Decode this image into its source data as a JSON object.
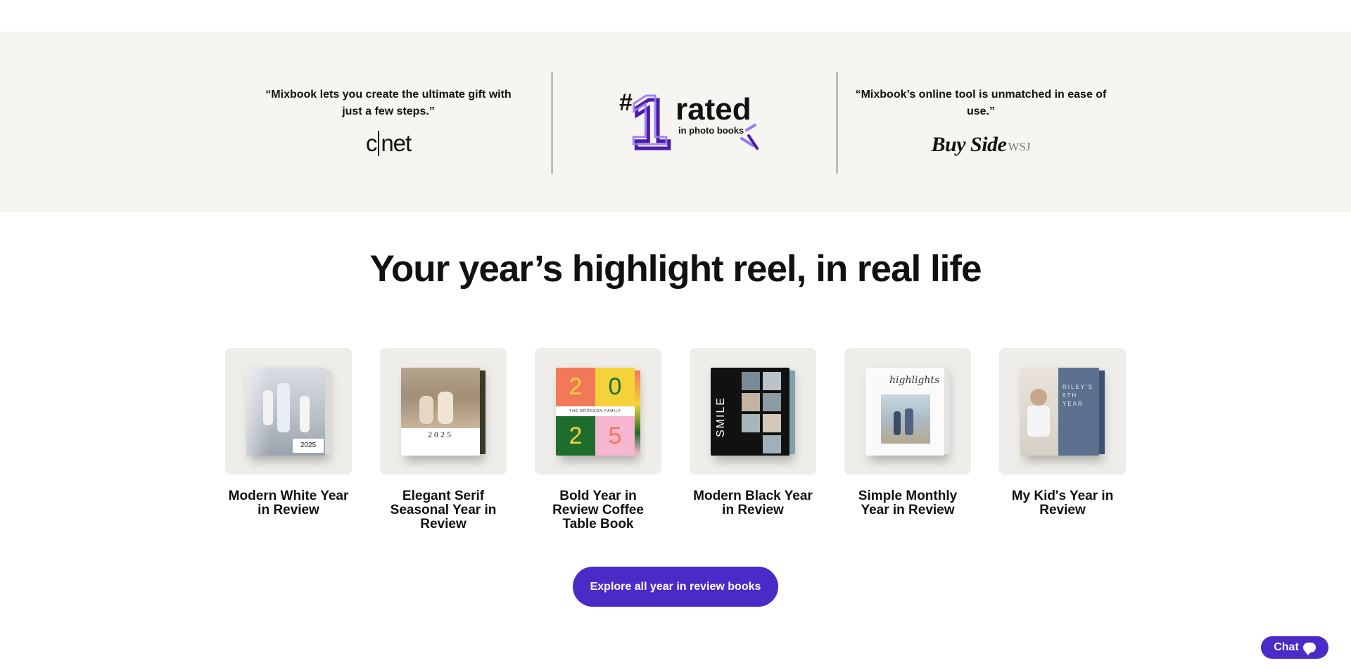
{
  "press": {
    "cnet_quote": "“Mixbook lets you create the ultimate gift with just a few steps.”",
    "cnet_logo": "cnet",
    "badge_hash": "#",
    "badge_number": "1",
    "badge_word": "rated",
    "badge_sub": "in photo books",
    "buyside_quote": "“Mixbook’s online tool is unmatched in ease of use.”",
    "buyside_logo": "Buy Side",
    "buyside_logo_sub": "WSJ"
  },
  "headline": "Your year’s highlight reel, in real life",
  "cards": [
    {
      "title": "Modern White Year in Review",
      "cover_text": "2025"
    },
    {
      "title": "Elegant Serif Seasonal Year in Review",
      "cover_text": "2025"
    },
    {
      "title": "Bold Year in Review Coffee Table Book",
      "cover_digits": [
        "2",
        "0",
        "2",
        "5"
      ],
      "cover_text": "THE BRONSON FAMILY"
    },
    {
      "title": "Modern Black Year in Review",
      "cover_text": "SMILE"
    },
    {
      "title": "Simple Monthly Year in Review",
      "cover_text": "highlights"
    },
    {
      "title": "My Kid's Year in Review",
      "cover_text": "RILEY'S 6TH YEAR"
    }
  ],
  "cta_label": "Explore all year in review books",
  "chat_label": "Chat",
  "colors": {
    "accent": "#4a2bc8",
    "band_bg": "#f6f5f1",
    "card_bg": "#eeede9",
    "badge_light": "#9a7bf5",
    "badge_dark": "#4a1aa8"
  }
}
